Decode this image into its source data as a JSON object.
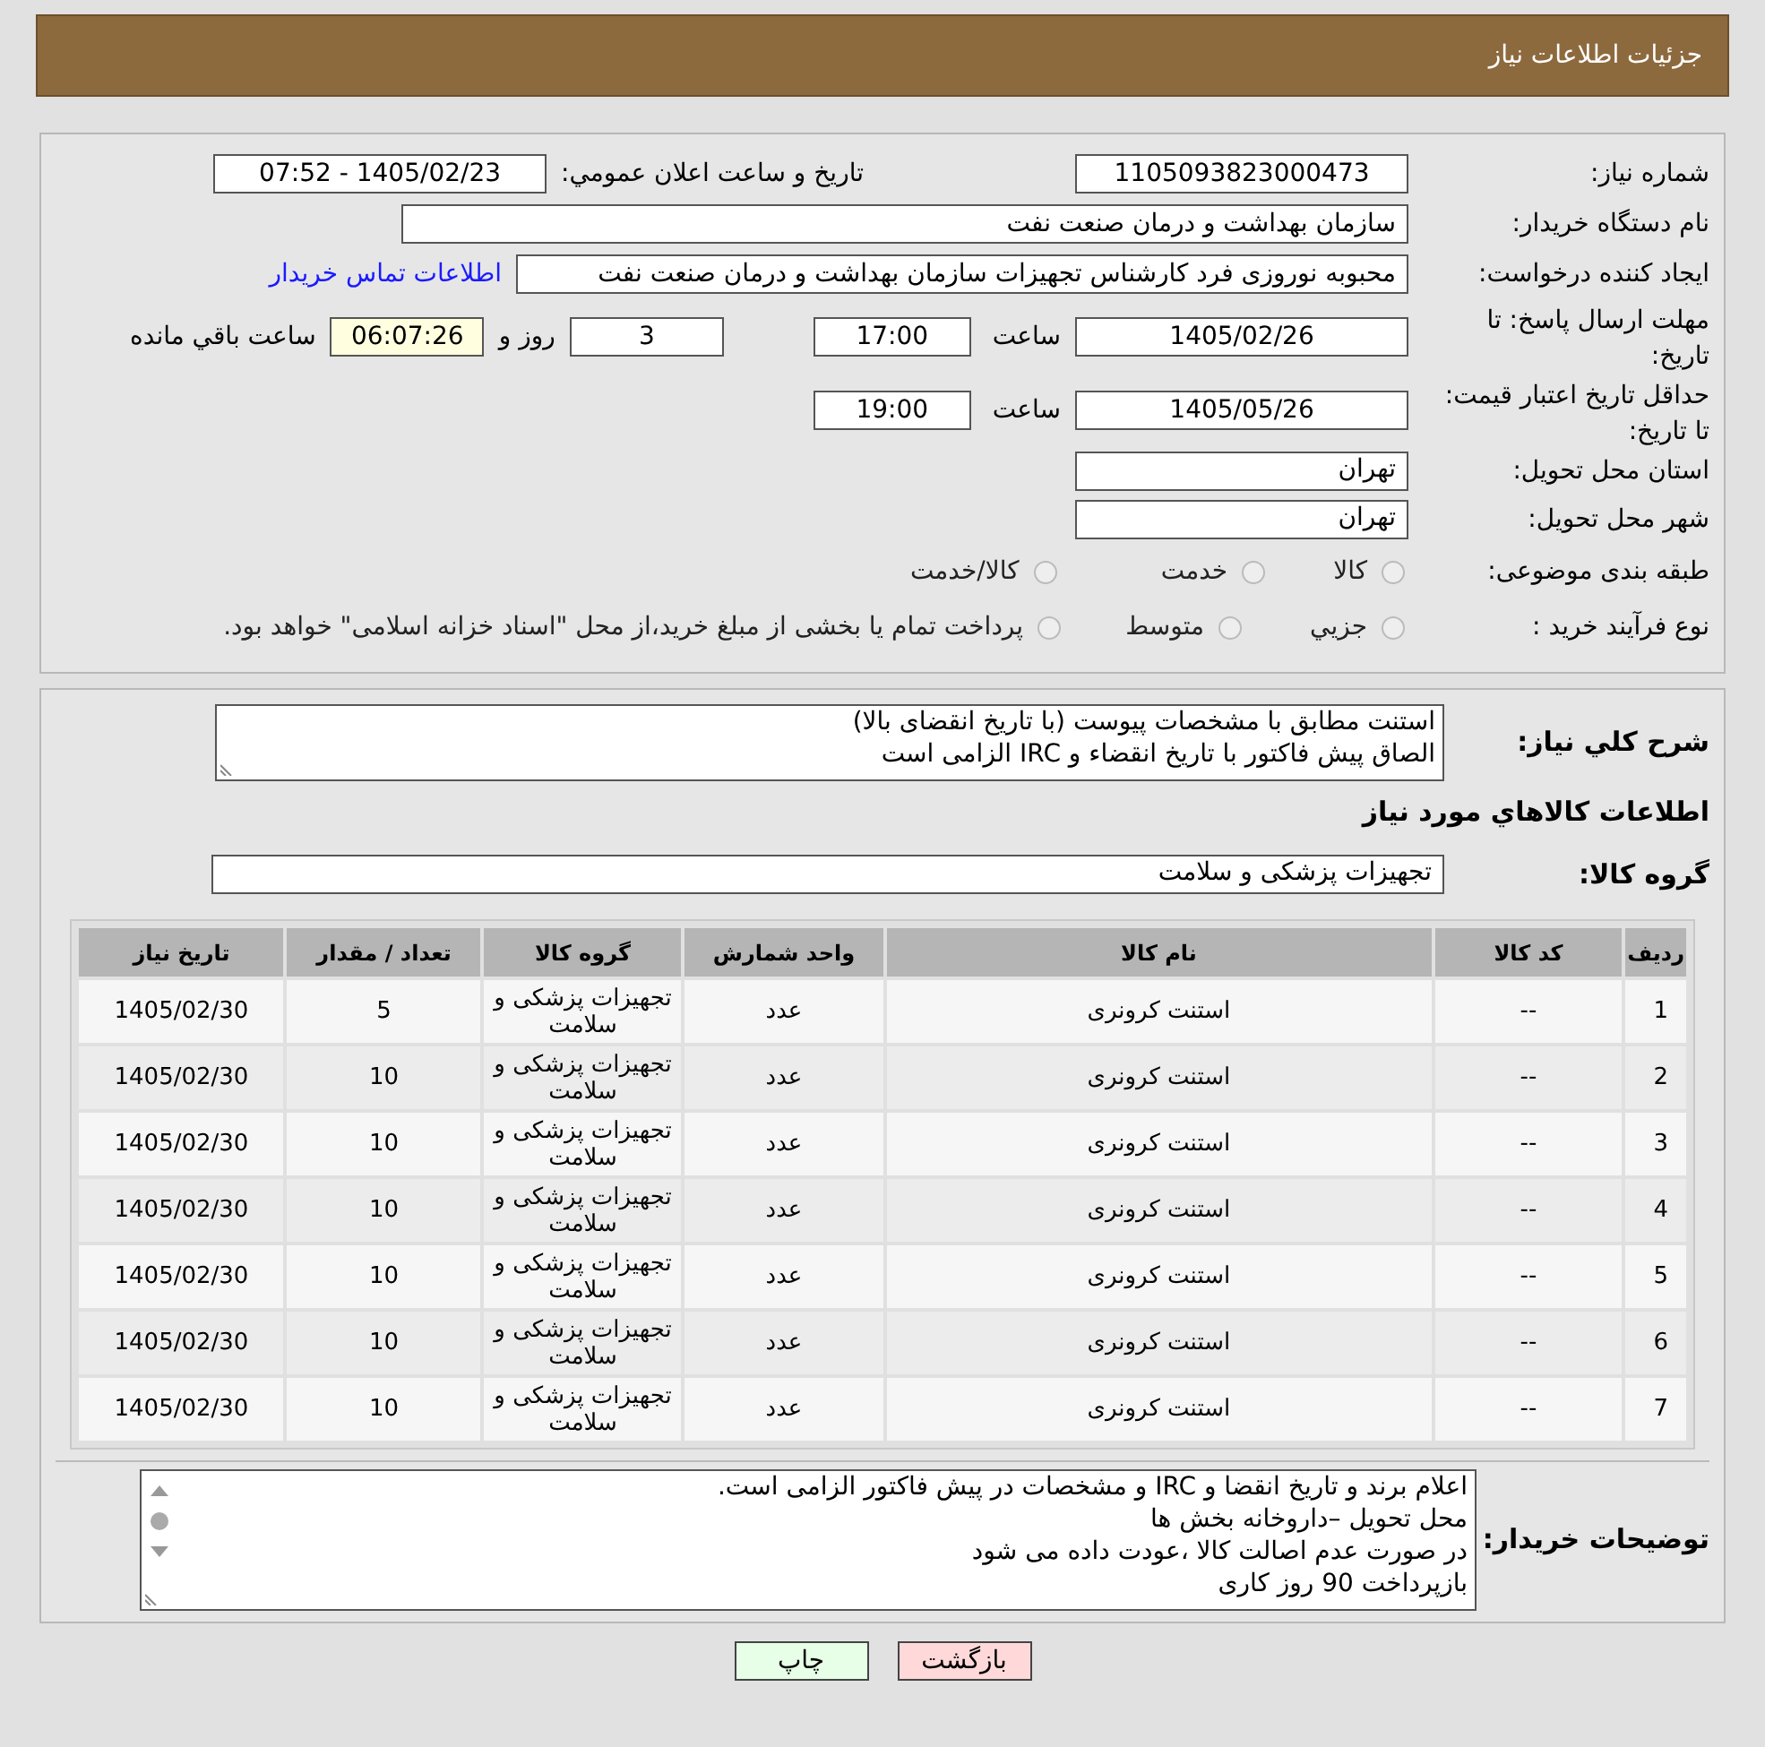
{
  "header": {
    "title": "جزئیات اطلاعات نیاز"
  },
  "need_number": {
    "label": "شماره نیاز:",
    "value": "1105093823000473"
  },
  "announce": {
    "label": "تاریخ و ساعت اعلان عمومي:",
    "value": "1405/02/23 - 07:52"
  },
  "buyer_org": {
    "label": "نام دستگاه خریدار:",
    "value": "سازمان بهداشت و درمان صنعت نفت"
  },
  "requester": {
    "label": "ایجاد کننده درخواست:",
    "value": "محبوبه نوروزی فرد کارشناس تجهیزات سازمان بهداشت و درمان صنعت نفت",
    "link": "اطلاعات تماس خریدار"
  },
  "reply_deadline": {
    "label": "مهلت ارسال پاسخ: تا تاریخ:",
    "date": "1405/02/26",
    "time_label": "ساعت",
    "time": "17:00",
    "days": "3",
    "days_label": "روز و",
    "remaining": "06:07:26",
    "remaining_label": "ساعت باقي مانده"
  },
  "price_validity": {
    "label": "حداقل تاریخ اعتبار قیمت: تا تاریخ:",
    "date": "1405/05/26",
    "time_label": "ساعت",
    "time": "19:00"
  },
  "province": {
    "label": "استان محل تحویل:",
    "value": "تهران"
  },
  "city": {
    "label": "شهر محل تحویل:",
    "value": "تهران"
  },
  "category": {
    "label": "طبقه بندی موضوعی:",
    "options": [
      {
        "label": "کالا",
        "selected": false
      },
      {
        "label": "خدمت",
        "selected": false
      },
      {
        "label": "کالا/خدمت",
        "selected": false
      }
    ]
  },
  "purchase_type": {
    "label": "نوع فرآیند خرید :",
    "options": [
      {
        "label": "جزيي",
        "selected": false
      },
      {
        "label": "متوسط",
        "selected": false
      },
      {
        "label": "پرداخت تمام یا بخشی از مبلغ خرید،از محل \"اسناد خزانه اسلامی\" خواهد بود.",
        "selected": false
      }
    ]
  },
  "description": {
    "label": "شرح کلي نیاز:",
    "value": "استنت مطابق با مشخصات پیوست (با تاریخ انقضای بالا)\nالصاق پیش فاکتور با تاریخ انقضاء و IRC الزامی است"
  },
  "goods_heading": "اطلاعات کالاهاي مورد نیاز",
  "goods_group": {
    "label": "گروه کالا:",
    "value": "تجهیزات پزشکی و سلامت"
  },
  "table": {
    "columns": [
      "ردیف",
      "کد کالا",
      "نام کالا",
      "واحد شمارش",
      "گروه کالا",
      "تعداد / مقدار",
      "تاریخ نیاز"
    ],
    "rows": [
      [
        "1",
        "--",
        "استنت کرونری",
        "عدد",
        "تجهیزات پزشکی و سلامت",
        "5",
        "1405/02/30"
      ],
      [
        "2",
        "--",
        "استنت کرونری",
        "عدد",
        "تجهیزات پزشکی و سلامت",
        "10",
        "1405/02/30"
      ],
      [
        "3",
        "--",
        "استنت کرونری",
        "عدد",
        "تجهیزات پزشکی و سلامت",
        "10",
        "1405/02/30"
      ],
      [
        "4",
        "--",
        "استنت کرونری",
        "عدد",
        "تجهیزات پزشکی و سلامت",
        "10",
        "1405/02/30"
      ],
      [
        "5",
        "--",
        "استنت کرونری",
        "عدد",
        "تجهیزات پزشکی و سلامت",
        "10",
        "1405/02/30"
      ],
      [
        "6",
        "--",
        "استنت کرونری",
        "عدد",
        "تجهیزات پزشکی و سلامت",
        "10",
        "1405/02/30"
      ],
      [
        "7",
        "--",
        "استنت کرونری",
        "عدد",
        "تجهیزات پزشکی و سلامت",
        "10",
        "1405/02/30"
      ]
    ]
  },
  "buyer_notes": {
    "label": "توضیحات خریدار:",
    "value": "اعلام برند و تاریخ انقضا و IRC و مشخصات در پیش فاکتور الزامی است.\nمحل تحویل –داروخانه بخش ها\nدر صورت عدم اصالت کالا ،عودت داده می شود\nبازپرداخت 90 روز کاری"
  },
  "buttons": [
    {
      "label": "بازگشت",
      "kind": "back"
    },
    {
      "label": "چاپ",
      "kind": "print"
    }
  ]
}
